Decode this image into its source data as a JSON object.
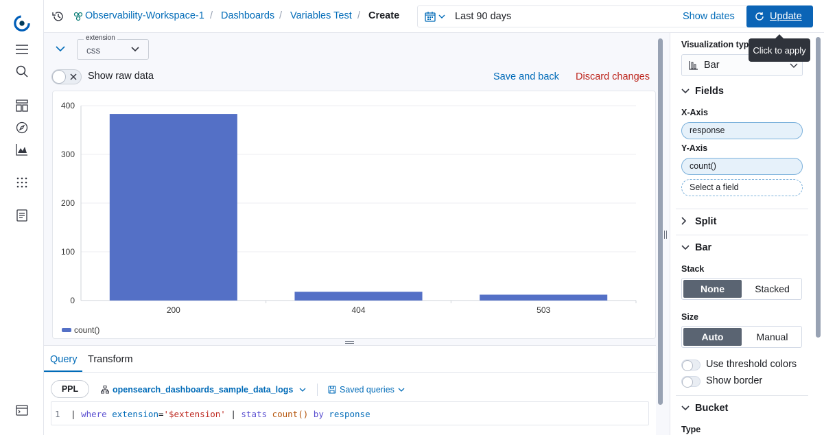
{
  "breadcrumbs": [
    "Observability-Workspace-1",
    "Dashboards",
    "Variables Test",
    "Create"
  ],
  "date_picker": {
    "range": "Last 90 days",
    "show_dates": "Show dates"
  },
  "update_button": "Update",
  "tooltip": "Click to apply",
  "variable": {
    "label": "extension",
    "value": "css"
  },
  "raw_toggle_label": "Show raw data",
  "save_and_back": "Save and back",
  "discard_changes": "Discard changes",
  "chart_data": {
    "type": "bar",
    "categories": [
      "200",
      "404",
      "503"
    ],
    "series": [
      {
        "name": "count()",
        "values": [
          383,
          18,
          12
        ],
        "color": "#5470c6"
      }
    ],
    "ylim": [
      0,
      400
    ],
    "yticks": [
      0,
      100,
      200,
      300,
      400
    ],
    "legend": "bottom-left",
    "grid": true
  },
  "query_tabs": [
    "Query",
    "Transform"
  ],
  "query_language": "PPL",
  "datasource": "opensearch_dashboards_sample_data_logs",
  "saved_queries": "Saved queries",
  "code": {
    "line_number": "1",
    "pipe1": "|",
    "kw_where": "where",
    "field_ext": "extension",
    "eq": "=",
    "str_value": "'$extension'",
    "pipe2": "|",
    "kw_stats": "stats",
    "fn_count": "count()",
    "kw_by": "by",
    "field_resp": "response"
  },
  "panel": {
    "viz_type_label": "Visualization type",
    "viz_type_value": "Bar",
    "fields_title": "Fields",
    "x_axis_label": "X-Axis",
    "x_axis_value": "response",
    "y_axis_label": "Y-Axis",
    "y_axis_value": "count()",
    "select_field": "Select a field",
    "split_title": "Split",
    "bar_title": "Bar",
    "stack_label": "Stack",
    "stack_options": [
      "None",
      "Stacked"
    ],
    "size_label": "Size",
    "size_options": [
      "Auto",
      "Manual"
    ],
    "threshold_colors": "Use threshold colors",
    "show_border": "Show border",
    "bucket_title": "Bucket",
    "type_label": "Type"
  },
  "colors": {
    "accent": "#0b64b6",
    "link": "#006bb8",
    "danger": "#bd271e",
    "bar": "#5470c6"
  }
}
